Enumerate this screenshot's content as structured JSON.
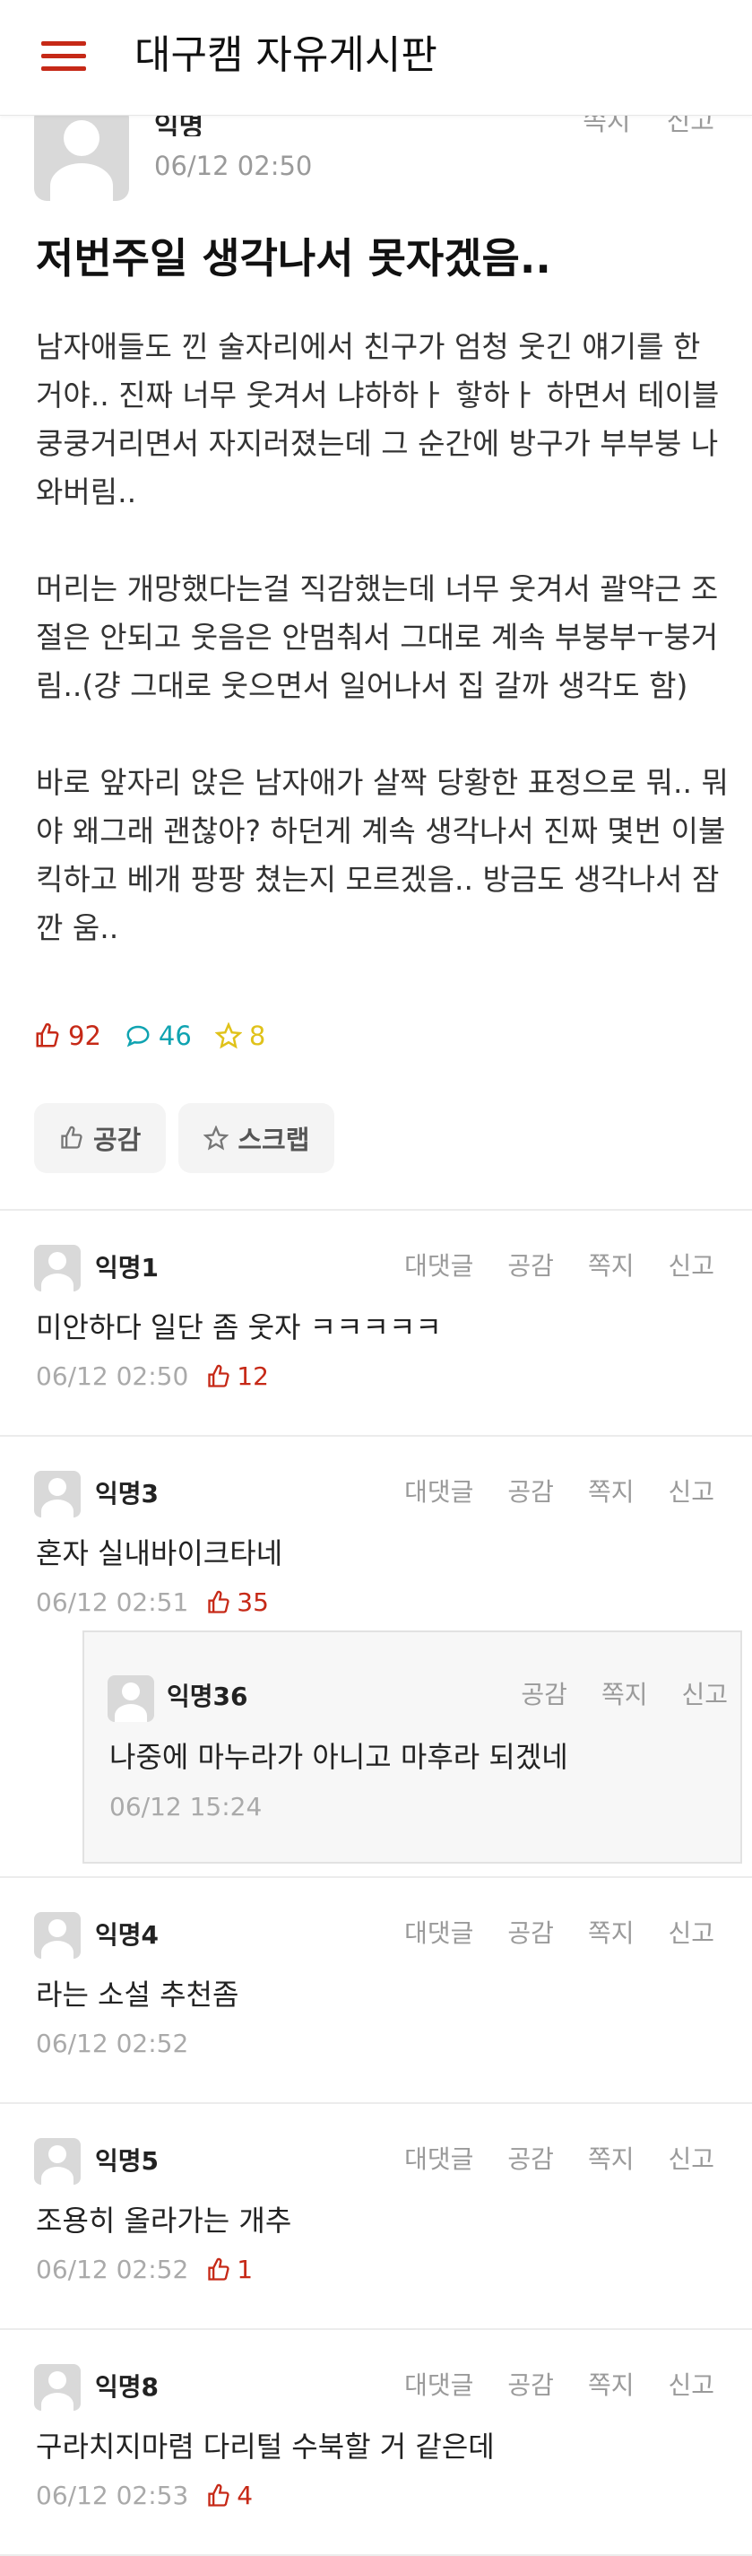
{
  "header": {
    "title": "대구캠 자유게시판"
  },
  "article": {
    "author": "익명",
    "date": "06/12 02:50",
    "actions": [
      "쪽지",
      "신고"
    ],
    "title": "저번주일 생각나서 못자겠음..",
    "paragraphs": [
      "남자애들도 낀 술자리에서 친구가 엄청 웃긴 얘기를 한 거야.. 진짜 너무 웃겨서 냐하하ㅏ 핳하ㅏ 하면서 테이블 쿵쿵거리면서 자지러졌는데 그 순간에 방구가 부부붕 나와버림..",
      "머리는 개망했다는걸 직감했는데 너무 웃겨서 괄약근 조절은 안되고 웃음은 안멈춰서 그대로 계속 부붕부ㅜ붕거림..(걍 그대로 웃으면서 일어나서 집 갈까 생각도 함)",
      "바로 앞자리 앉은 남자애가 살짝 당황한 표정으로 뭐.. 뭐야 왜그래 괜찮아? 하던게 계속 생각나서 진짜 몇번 이불킥하고 베개 팡팡 쳤는지 모르겠음.. 방금도 생각나서 잠깐 움.."
    ],
    "likes": "92",
    "comments": "46",
    "scraps": "8",
    "like_button": "공감",
    "scrap_button": "스크랩",
    "colors": {
      "accent": "#c62917",
      "comment": "#0fa3b1",
      "scrap": "#e0c21a"
    }
  },
  "comment_actions": {
    "reply": "대댓글",
    "like": "공감",
    "message": "쪽지",
    "report": "신고"
  },
  "comments": [
    {
      "author": "익명1",
      "text": "미안하다 일단 좀 웃자 ㅋㅋㅋㅋㅋ",
      "date": "06/12 02:50",
      "likes": "12"
    },
    {
      "author": "익명3",
      "text": "혼자 실내바이크타네",
      "date": "06/12 02:51",
      "likes": "35",
      "reply": {
        "author": "익명36",
        "text": "나중에 마누라가 아니고 마후라 되겠네",
        "date": "06/12 15:24"
      }
    },
    {
      "author": "익명4",
      "text": "라는 소설 추천좀",
      "date": "06/12 02:52"
    },
    {
      "author": "익명5",
      "text": "조용히 올라가는 개추",
      "date": "06/12 02:52",
      "likes": "1"
    },
    {
      "author": "익명8",
      "text": "구라치지마렴 다리털 수북할 거 같은데",
      "date": "06/12 02:53",
      "likes": "4"
    }
  ]
}
